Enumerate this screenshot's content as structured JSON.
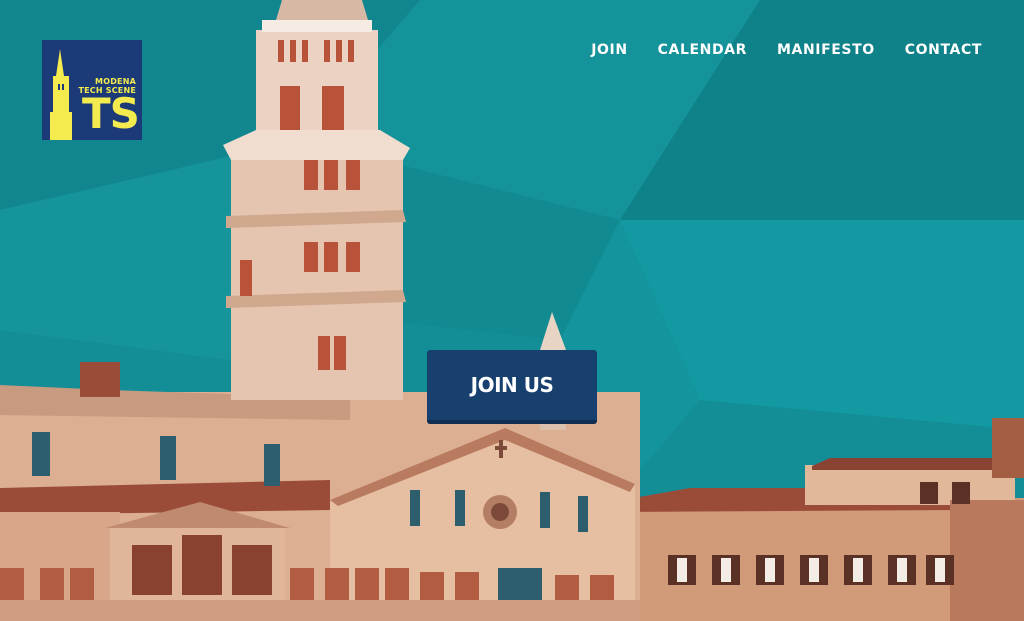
{
  "brand": {
    "line1": "MODENA",
    "line2": "TECH SCENE",
    "mark": "TS",
    "icon": "tower-icon",
    "background": "#1c3a78",
    "foreground": "#f4ec4e"
  },
  "nav": {
    "items": [
      {
        "label": "JOIN"
      },
      {
        "label": "CALENDAR"
      },
      {
        "label": "MANIFESTO"
      },
      {
        "label": "CONTACT"
      }
    ]
  },
  "hero": {
    "cta_label": "JOIN US",
    "background_color": "#138e96",
    "cta_color": "#17406e",
    "image": "photo of Modena Cathedral and Ghirlandina tower"
  }
}
